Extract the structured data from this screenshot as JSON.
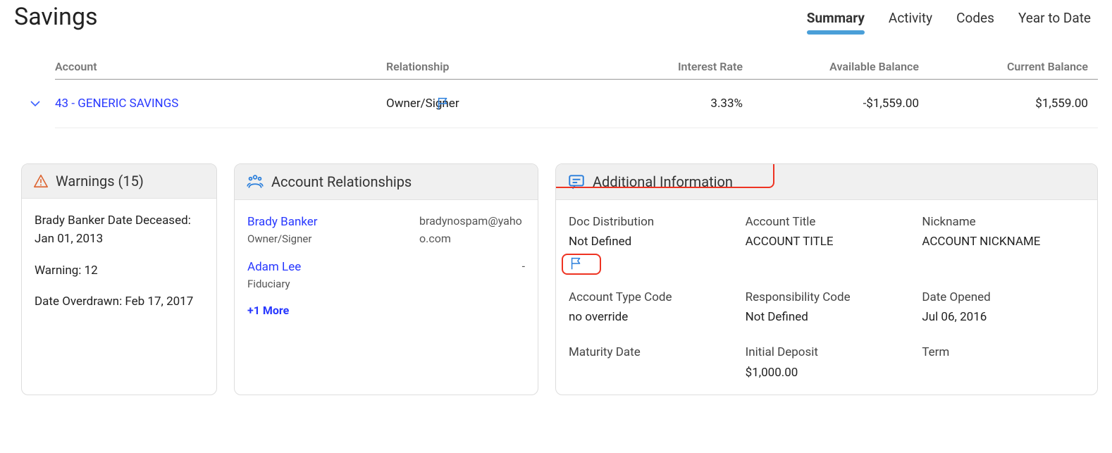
{
  "page_title": "Savings",
  "tabs": [
    {
      "label": "Summary",
      "active": true
    },
    {
      "label": "Activity",
      "active": false
    },
    {
      "label": "Codes",
      "active": false
    },
    {
      "label": "Year to Date",
      "active": false
    }
  ],
  "table": {
    "headers": {
      "account": "Account",
      "relationship": "Relationship",
      "interest_rate": "Interest Rate",
      "available_balance": "Available Balance",
      "current_balance": "Current Balance"
    },
    "rows": [
      {
        "account": "43 - GENERIC SAVINGS",
        "relationship": "Owner/Signer",
        "interest_rate": "3.33%",
        "available_balance": "-$1,559.00",
        "current_balance": "$1,559.00"
      }
    ]
  },
  "warnings": {
    "title": "Warnings (15)",
    "items": [
      "Brady Banker Date Deceased: Jan 01, 2013",
      "Warning: 12",
      "Date Overdrawn: Feb 17, 2017"
    ]
  },
  "relationships": {
    "title": "Account Relationships",
    "entries": [
      {
        "name": "Brady Banker",
        "role": "Owner/Signer",
        "email": "bradynospam@yahoo.com"
      },
      {
        "name": "Adam Lee",
        "role": "Fiduciary",
        "email": "-"
      }
    ],
    "more": "+1 More"
  },
  "addinfo": {
    "title": "Additional Information",
    "fields": [
      {
        "label": "Doc Distribution",
        "value": "Not Defined",
        "flag": true
      },
      {
        "label": "Account Title",
        "value": "ACCOUNT TITLE"
      },
      {
        "label": "Nickname",
        "value": "ACCOUNT NICKNAME"
      },
      {
        "label": "Account Type Code",
        "value": "no override"
      },
      {
        "label": "Responsibility Code",
        "value": "Not Defined"
      },
      {
        "label": "Date Opened",
        "value": "Jul 06, 2016"
      },
      {
        "label": "Maturity Date",
        "value": ""
      },
      {
        "label": "Initial Deposit",
        "value": "$1,000.00"
      },
      {
        "label": "Term",
        "value": ""
      }
    ]
  }
}
